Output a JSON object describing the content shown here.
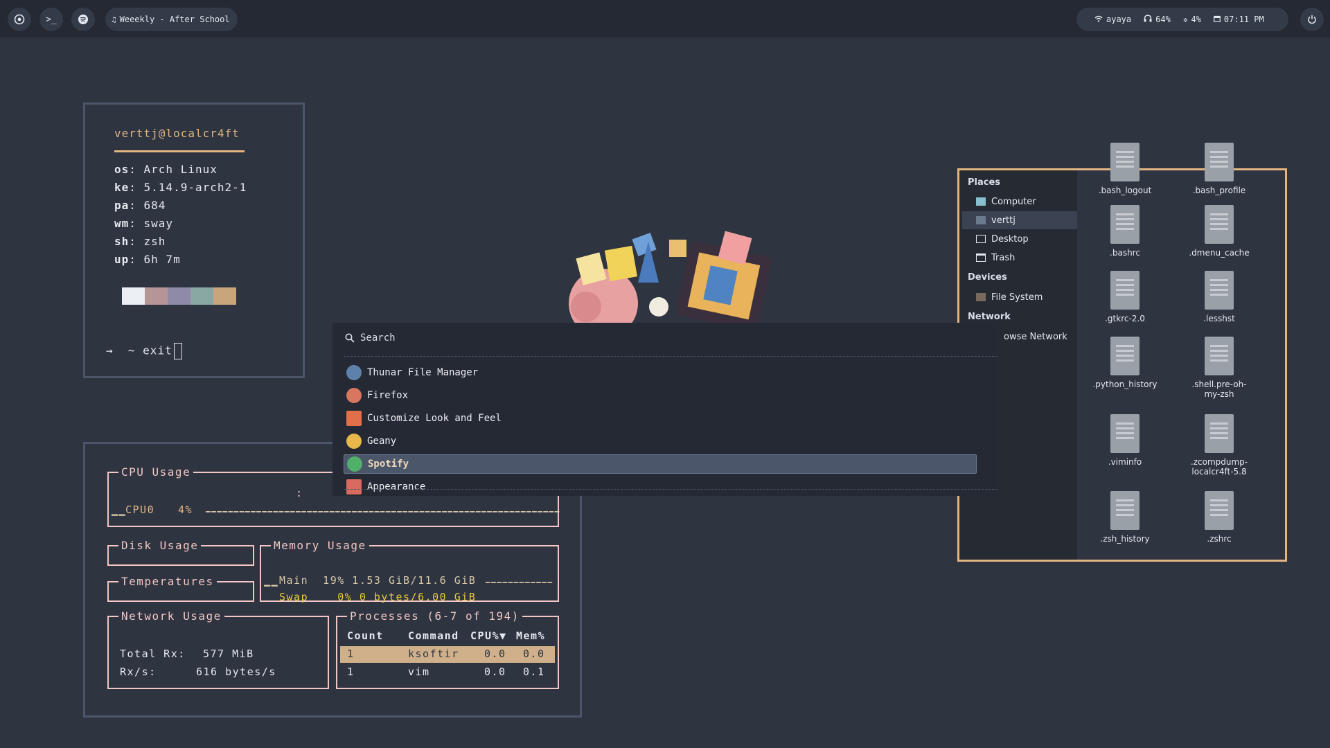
{
  "topbar": {
    "left_icons": [
      "chrome-icon",
      "terminal-icon",
      "spotify-icon"
    ],
    "terminal_glyph": ">_",
    "music": {
      "icon": "music-note-icon",
      "text": "Weeekly - After School"
    },
    "status": {
      "wifi": "ayaya",
      "headphones": "64%",
      "brightness": "4%",
      "time": "07:11 PM"
    },
    "power_icon": "power-icon"
  },
  "fetch": {
    "user": "verttj@localcr4ft",
    "rows": [
      {
        "key": "os",
        "value": "Arch Linux"
      },
      {
        "key": "ke",
        "value": "5.14.9-arch2-1"
      },
      {
        "key": "pa",
        "value": "684"
      },
      {
        "key": "wm",
        "value": "sway"
      },
      {
        "key": "sh",
        "value": "zsh"
      },
      {
        "key": "up",
        "value": "6h 7m"
      }
    ],
    "swatches": [
      "#eceff4",
      "#b59595",
      "#8e8aa8",
      "#8aa8a3",
      "#c8a57a"
    ],
    "prompt_arrow": "→",
    "prompt_text": "~ exit"
  },
  "btop": {
    "cpu": {
      "title": "CPU Usage",
      "core": "CPU0",
      "percent": "4%",
      "spark_left": "▁▁",
      "colon": ":"
    },
    "disk": {
      "title": "Disk Usage"
    },
    "temps": {
      "title": "Temperatures"
    },
    "memory": {
      "title": "Memory Usage",
      "main": "Main  19% 1.53 GiB/11.6 GiB",
      "swap": "Swap    0% 0 bytes/6.00 GiB",
      "spark_left": "▁▁"
    },
    "network": {
      "title": "Network Usage",
      "rx_total_label": "Total Rx:",
      "rx_total": "577 MiB",
      "rx_rate_label": "Rx/s:",
      "rx_rate": "616 bytes/s"
    },
    "processes": {
      "title": "Processes (6-7 of 194)",
      "columns": [
        "Count",
        "Command",
        "CPU%▼",
        "Mem%"
      ],
      "rows": [
        {
          "count": "1",
          "command": "ksoftir",
          "cpu": "0.0",
          "mem": "0.0"
        },
        {
          "count": "1",
          "command": "vim",
          "cpu": "0.0",
          "mem": "0.1"
        }
      ]
    }
  },
  "launcher": {
    "placeholder": "Search",
    "items": [
      {
        "label": "Thunar File Manager",
        "color": "#5e81ac"
      },
      {
        "label": "Firefox",
        "color": "#d9765f"
      },
      {
        "label": "Customize Look and Feel",
        "color": "#e0704a"
      },
      {
        "label": "Geany",
        "color": "#e8b84a"
      },
      {
        "label": "Spotify",
        "color": "#4fb06a"
      },
      {
        "label": "Appearance",
        "color": "#d86b5f"
      }
    ],
    "selected_index": 4
  },
  "thunar": {
    "places_header": "Places",
    "places": [
      "Computer",
      "verttj",
      "Desktop",
      "Trash"
    ],
    "devices_header": "Devices",
    "devices": [
      "File System"
    ],
    "network_header": "Network",
    "network_item": "owse Network",
    "files": [
      ".bash_logout",
      ".bash_profile",
      ".bashrc",
      ".dmenu_cache",
      ".gtkrc-2.0",
      ".lesshst",
      ".python_history",
      ".shell.pre-oh-\nmy-zsh",
      ".viminfo",
      ".zcompdump-\nlocalcr4ft-5.8",
      ".zsh_history",
      ".zshrc"
    ]
  },
  "colors": {
    "accent": "#e2b581",
    "btop_border": "#f2c7c4",
    "background": "#2e3440"
  }
}
